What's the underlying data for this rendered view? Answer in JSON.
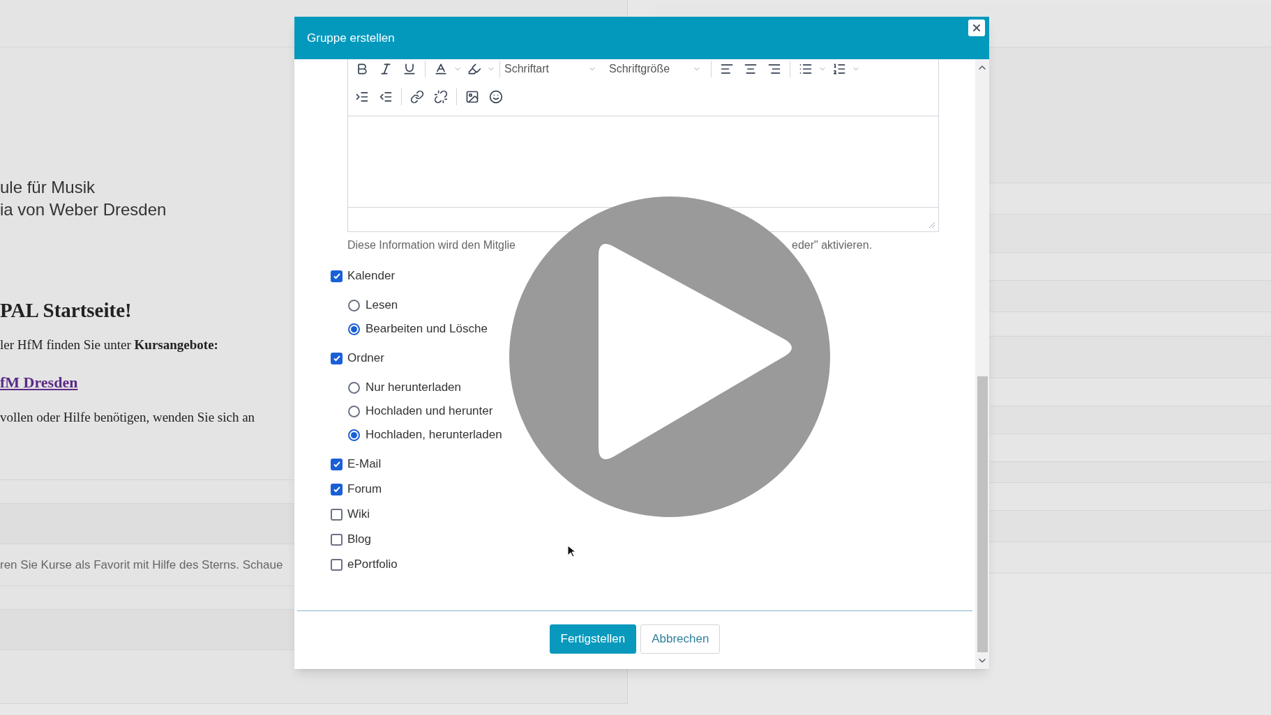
{
  "background": {
    "school_lines": [
      "ule für Musik",
      "ia von Weber Dresden"
    ],
    "heading": "PAL Startseite!",
    "intro": "ler HfM finden Sie unter **Kursangebote:**",
    "link": "fM Dresden",
    "help": "vollen oder Hilfe benötigen, wenden Sie sich an",
    "favorites_hint": "ren Sie Kurse als Favorit mit Hilfe des Sterns. Schaue"
  },
  "dialog": {
    "title": "Gruppe erstellen",
    "editor": {
      "font_select": "Schriftart",
      "size_select": "Schriftgröße"
    },
    "hint": [
      "Diese Information wird den Mitglie",
      "eder\" aktivieren."
    ],
    "tools": [
      {
        "label": "Kalender",
        "checked": true,
        "options": [
          {
            "label": "Lesen",
            "selected": false
          },
          {
            "label": "Bearbeiten und Lösche",
            "selected": true
          }
        ]
      },
      {
        "label": "Ordner",
        "checked": true,
        "options": [
          {
            "label": "Nur herunterladen",
            "selected": false
          },
          {
            "label": "Hochladen und herunter",
            "selected": false
          },
          {
            "label": "Hochladen, herunterladen",
            "selected": true
          }
        ]
      },
      {
        "label": "E-Mail",
        "checked": true
      },
      {
        "label": "Forum",
        "checked": true
      },
      {
        "label": "Wiki",
        "checked": false
      },
      {
        "label": "Blog",
        "checked": false
      },
      {
        "label": "ePortfolio",
        "checked": false
      }
    ],
    "buttons": [
      {
        "label": "Fertigstellen",
        "kind": "primary"
      },
      {
        "label": "Abbrechen",
        "kind": "secondary"
      }
    ]
  },
  "video": {
    "kind": "play_overlay"
  }
}
